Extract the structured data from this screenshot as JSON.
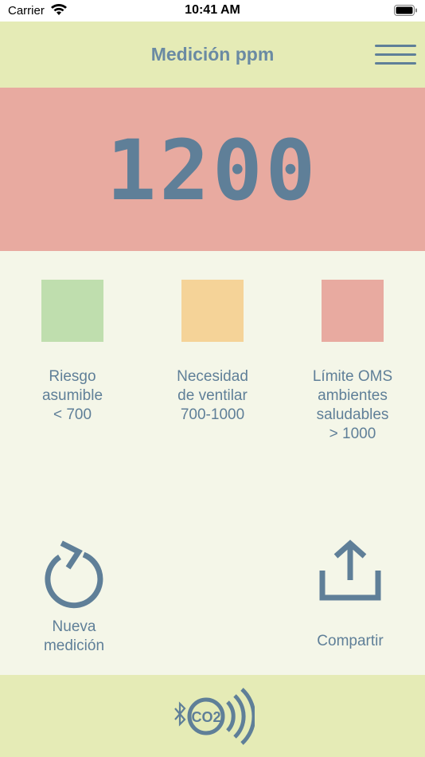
{
  "status_bar": {
    "carrier": "Carrier",
    "time": "10:41 AM"
  },
  "header": {
    "title": "Medición ppm"
  },
  "reading": {
    "value": "1200",
    "level_color": "#e8aaa0"
  },
  "legend": [
    {
      "color": "#bfdeae",
      "label": "Riesgo\nasumible\n< 700"
    },
    {
      "color": "#f5d398",
      "label": "Necesidad\nde ventilar\n700-1000"
    },
    {
      "color": "#e8aaa0",
      "label": "Límite OMS\nambientes\nsaludables\n> 1000"
    }
  ],
  "actions": {
    "new_measurement": {
      "label": "Nueva\nmedición",
      "icon": "refresh-icon"
    },
    "share": {
      "label": "Compartir",
      "icon": "share-icon"
    }
  },
  "footer": {
    "logo_text": "CO2",
    "icon": "bluetooth-co2-icon"
  },
  "colors": {
    "accent": "#5f7f98",
    "header_bg": "#e5ebb6",
    "page_bg": "#f4f6e8"
  }
}
